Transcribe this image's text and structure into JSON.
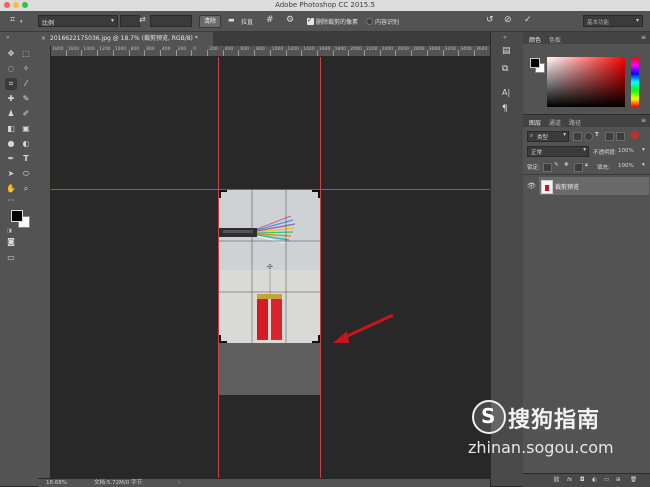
{
  "titlebar": {
    "title": "Adobe Photoshop CC 2015.5"
  },
  "options": {
    "ratio_value": "比例",
    "clear_label": "清除",
    "straighten_label": "拉直",
    "delete_cropped_label": "删除裁剪的像素",
    "content_aware_label": "内容识别",
    "workspace_value": "基本功能"
  },
  "document": {
    "tab_label": "20166221750​36.jpg @ 18.7% (裁剪预览, RGB/8) *",
    "zoom_status": "18.68%",
    "doc_status": "文档:5.72M/0 字节"
  },
  "ruler": {
    "h_ticks": [
      "1800",
      "1600",
      "1400",
      "1200",
      "1000",
      "800",
      "600",
      "400",
      "200",
      "0",
      "200",
      "400",
      "600",
      "800",
      "1000",
      "1200",
      "1400",
      "1600",
      "1800",
      "2000",
      "2200",
      "2400",
      "2600",
      "2800",
      "3000",
      "3200",
      "3400",
      "3600"
    ]
  },
  "panels": {
    "color_tab": "颜色",
    "swatches_tab": "色板",
    "layers_tab": "图层",
    "channels_tab": "通道",
    "paths_tab": "路径",
    "filter_kind": "类型",
    "blend_mode": "正常",
    "opacity_label": "不透明度:",
    "opacity_value": "100%",
    "lock_label": "锁定:",
    "fill_label": "填充:",
    "fill_value": "100%",
    "layer_name": "裁剪预览"
  },
  "watermark": {
    "brand": "搜狗指南",
    "url": "zhinan.sogou.com"
  },
  "colors": {
    "accent_red": "#c8414b",
    "arrow_red": "#c4161c",
    "panel_bg": "#535353",
    "canvas_bg": "#282828"
  }
}
